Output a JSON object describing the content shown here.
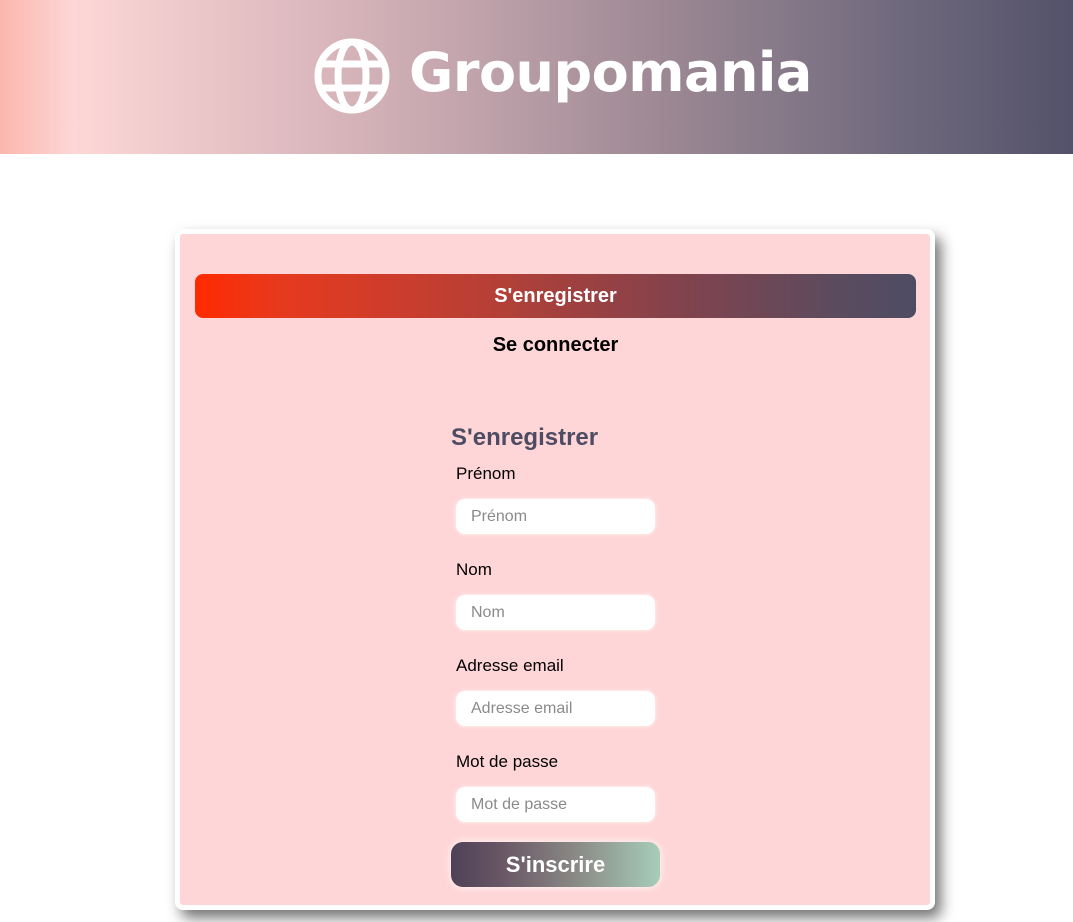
{
  "header": {
    "brand_name": "Groupomania",
    "logo_icon": "globe-icon"
  },
  "tabs": {
    "register_label": "S'enregistrer",
    "login_label": "Se connecter"
  },
  "form": {
    "title": "S'enregistrer",
    "fields": [
      {
        "label": "Prénom",
        "placeholder": "Prénom",
        "value": ""
      },
      {
        "label": "Nom",
        "placeholder": "Nom",
        "value": ""
      },
      {
        "label": "Adresse email",
        "placeholder": "Adresse email",
        "value": ""
      },
      {
        "label": "Mot de passe",
        "placeholder": "Mot de passe",
        "value": ""
      }
    ],
    "submit_label": "S'inscrire"
  },
  "colors": {
    "card_background": "#ffd6d7",
    "title_color": "#4e4c63",
    "accent_red": "#ff2a00",
    "accent_dark": "#4e4c63"
  }
}
